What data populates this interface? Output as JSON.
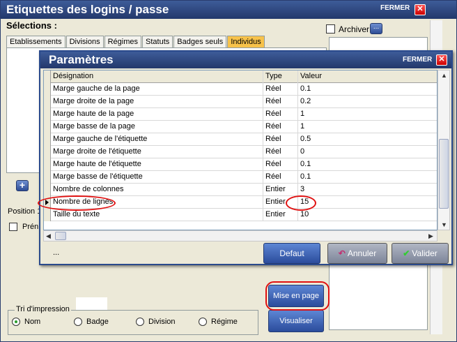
{
  "main": {
    "title": "Etiquettes des logins / passe",
    "close_label": "FERMER",
    "selections_label": "Sélections :",
    "archiver_label": "Archiver",
    "dots_label": "...",
    "tabs": [
      {
        "label": "Etablissements"
      },
      {
        "label": "Divisions"
      },
      {
        "label": "Régimes"
      },
      {
        "label": "Statuts"
      },
      {
        "label": "Badges seuls"
      },
      {
        "label": "Individus"
      }
    ],
    "position_label": "Position 1",
    "pren_label": "Prén",
    "mise_en_page_label": "Mise en page",
    "visualiser_label": "Visualiser",
    "tri": {
      "title": "Tri d'impression",
      "options": [
        "Nom",
        "Badge",
        "Division",
        "Régime"
      ],
      "selected": "Nom"
    }
  },
  "dialog": {
    "title": "Paramètres",
    "close_label": "FERMER",
    "columns": [
      "Désignation",
      "Type",
      "Valeur"
    ],
    "rows": [
      {
        "designation": "Marge gauche de la page",
        "type": "Réel",
        "valeur": "0.1"
      },
      {
        "designation": "Marge droite de la page",
        "type": "Réel",
        "valeur": "0.2"
      },
      {
        "designation": "Marge haute de la page",
        "type": "Réel",
        "valeur": "1"
      },
      {
        "designation": "Marge basse de la page",
        "type": "Réel",
        "valeur": "1"
      },
      {
        "designation": "Marge gauche de l'étiquette",
        "type": "Réel",
        "valeur": "0.5"
      },
      {
        "designation": "Marge droite de l'étiquette",
        "type": "Réel",
        "valeur": "0"
      },
      {
        "designation": "Marge haute de l'étiquette",
        "type": "Réel",
        "valeur": "0.1"
      },
      {
        "designation": "Marge basse de l'étiquette",
        "type": "Réel",
        "valeur": "0.1"
      },
      {
        "designation": "Nombre de colonnes",
        "type": "Entier",
        "valeur": "3"
      },
      {
        "designation": "Nombre de lignes",
        "type": "Entier",
        "valeur": "15"
      },
      {
        "designation": "Taille du texte",
        "type": "Entier",
        "valeur": "10"
      }
    ],
    "current_row": 9,
    "footer_text": "...",
    "defaut_label": "Defaut",
    "annuler_label": "Annuler",
    "valider_label": "Valider"
  },
  "colors": {
    "titlebar": "#2b4480",
    "active_tab": "#f7c24a",
    "button_blue": "#3a5fae",
    "annotation_red": "#e01010"
  }
}
